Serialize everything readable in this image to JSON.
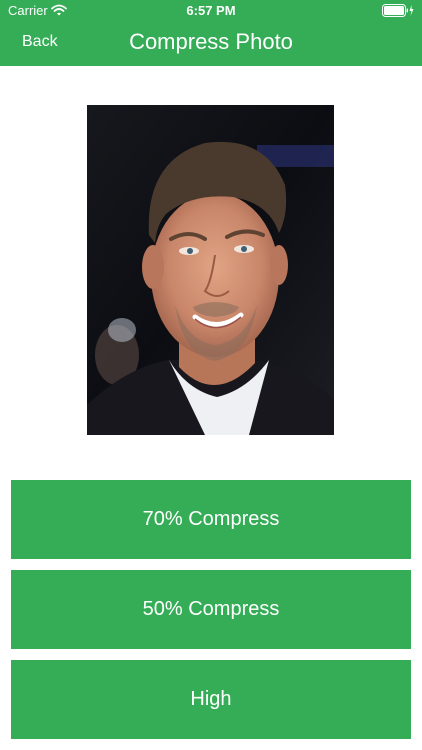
{
  "status_bar": {
    "carrier": "Carrier",
    "time": "6:57 PM",
    "wifi_icon": "wifi-icon",
    "battery_icon": "battery-charging-icon"
  },
  "nav_bar": {
    "back_label": "Back",
    "title": "Compress Photo"
  },
  "photo": {
    "subject": "portrait-photo"
  },
  "buttons": {
    "compress_70": "70% Compress",
    "compress_50": "50% Compress",
    "high": "High"
  },
  "colors": {
    "accent": "#34ad56",
    "text_on_accent": "#ffffff",
    "background": "#ffffff"
  }
}
